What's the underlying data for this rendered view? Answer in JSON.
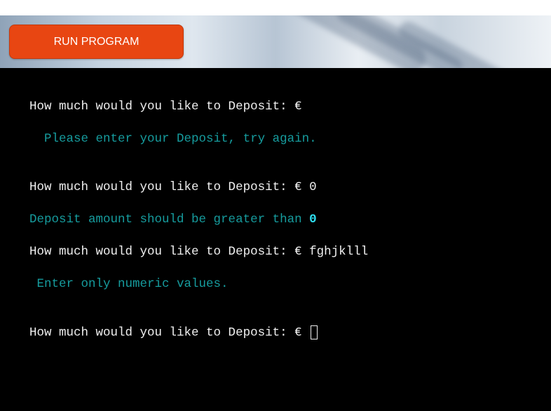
{
  "toolbar": {
    "run_label": "RUN PROGRAM",
    "accent_color": "#e84612"
  },
  "terminal": {
    "lines": [
      {
        "prompt": "How much would you like to Deposit: €",
        "input": ""
      },
      {
        "message": "  Please enter your Deposit, try again."
      },
      {
        "prompt": "How much would you like to Deposit: €",
        "input": " 0"
      },
      {
        "message": "Deposit amount should be greater than ",
        "highlight": "0"
      },
      {
        "prompt": "How much would you like to Deposit: €",
        "input": " fghjklll"
      },
      {
        "message": " Enter only numeric values."
      },
      {
        "prompt": "How much would you like to Deposit: €",
        "input": " "
      }
    ],
    "colors": {
      "background": "#000000",
      "prompt": "#f0f0f0",
      "message": "#169c9e",
      "highlight": "#2ee0f2"
    }
  }
}
